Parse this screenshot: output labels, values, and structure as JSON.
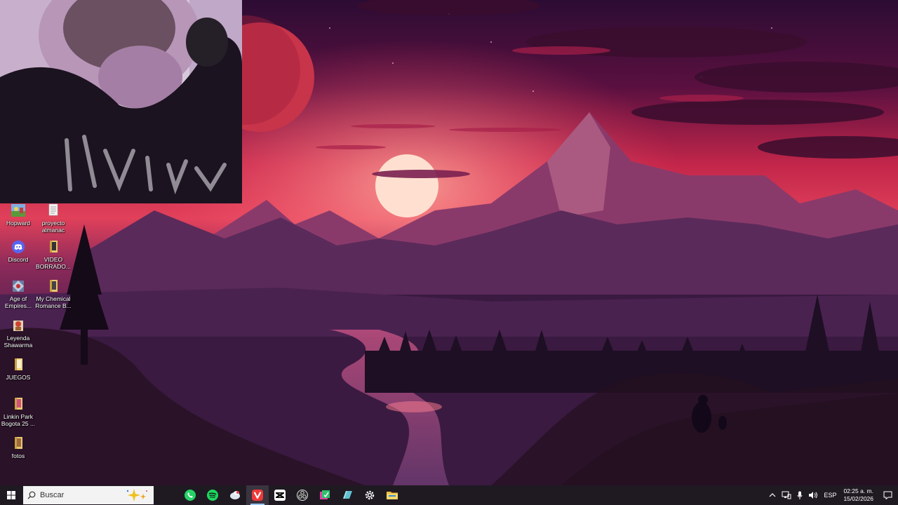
{
  "desktop": {
    "icons": [
      {
        "label": "Hopward",
        "icon": "game-shortcut-icon"
      },
      {
        "label": "proyecto\nalmanac",
        "icon": "text-file-icon"
      },
      {
        "label": "Discord",
        "icon": "discord-icon"
      },
      {
        "label": "VIDEO\nBORRADO...",
        "icon": "folder-icon"
      },
      {
        "label": "Age of\nEmpires...",
        "icon": "game-shortcut-icon"
      },
      {
        "label": "My Chemical\nRomance B...",
        "icon": "folder-icon"
      },
      {
        "label": "Leyenda\nShawarma",
        "icon": "game-shortcut-icon"
      },
      {
        "label": "JUEGOS",
        "icon": "folder-icon"
      },
      {
        "label": "Linkin Park\nBogota 25 ...",
        "icon": "folder-icon"
      },
      {
        "label": "fotos",
        "icon": "folder-icon"
      }
    ]
  },
  "webcam": {
    "description_icon": "webcam-overlay"
  },
  "taskbar": {
    "search_placeholder": "Buscar",
    "apps": [
      {
        "name": "whatsapp",
        "icon": "whatsapp-icon"
      },
      {
        "name": "spotify",
        "icon": "spotify-icon"
      },
      {
        "name": "app-3",
        "icon": "app-icon"
      },
      {
        "name": "vivaldi",
        "icon": "vivaldi-icon"
      },
      {
        "name": "capcut",
        "icon": "capcut-icon"
      },
      {
        "name": "obs",
        "icon": "obs-icon"
      },
      {
        "name": "app-7",
        "icon": "app-icon"
      },
      {
        "name": "app-8",
        "icon": "app-icon"
      },
      {
        "name": "settings",
        "icon": "gear-icon"
      },
      {
        "name": "file-explorer",
        "icon": "folder-icon"
      }
    ],
    "tray": {
      "language": "ESP",
      "time": "02:25 a. m.",
      "date": "15/02/2026"
    }
  },
  "colors": {
    "taskbar_bg": "#1f1a22",
    "sky_top": "#3a0f3a",
    "sky_mid": "#c3264a",
    "accent": "#9ec9ff"
  }
}
